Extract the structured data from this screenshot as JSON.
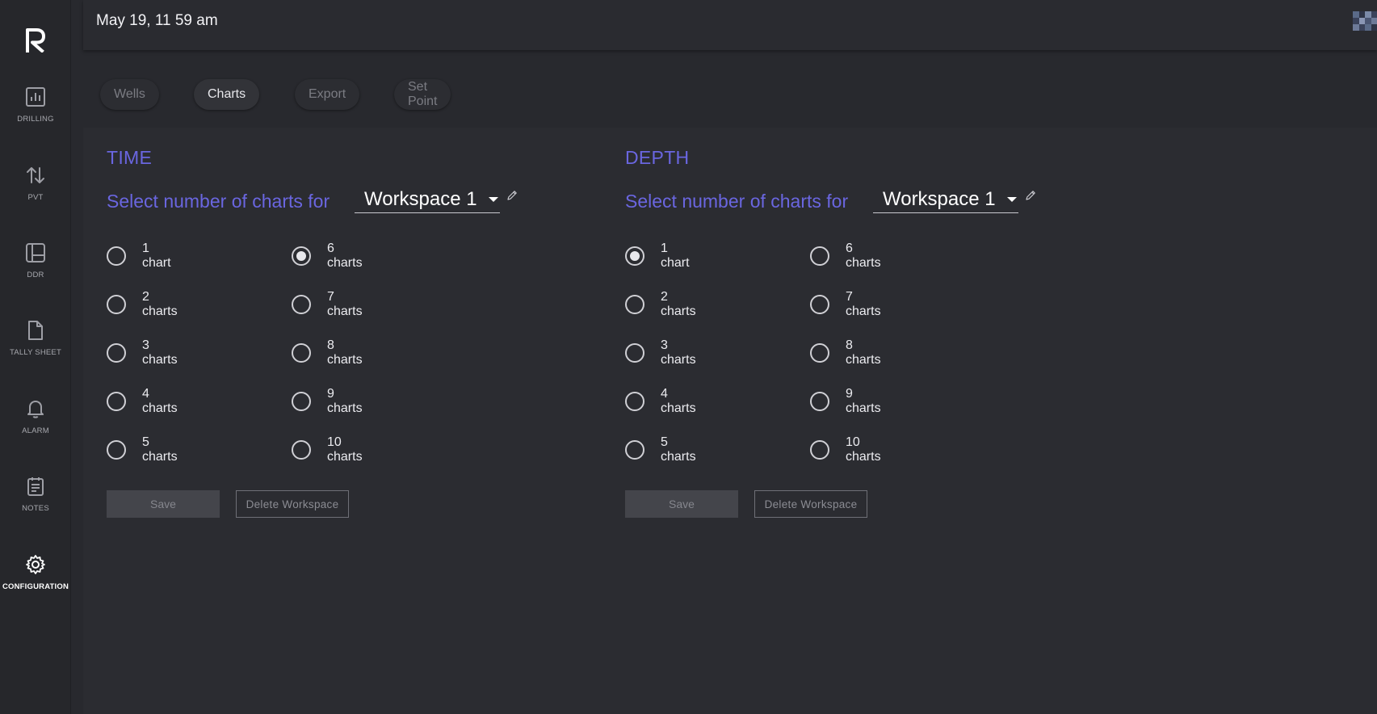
{
  "header": {
    "datetime": "May 19, 11 59 am"
  },
  "sidebar": {
    "items": [
      {
        "label": "DRILLING",
        "icon": "bar-chart-icon"
      },
      {
        "label": "PVT",
        "icon": "sort-arrows-icon"
      },
      {
        "label": "DDR",
        "icon": "layout-icon"
      },
      {
        "label": "TALLY SHEET",
        "icon": "document-icon"
      },
      {
        "label": "ALARM",
        "icon": "bell-icon"
      },
      {
        "label": "NOTES",
        "icon": "notes-icon"
      },
      {
        "label": "CONFIGURATION",
        "icon": "gear-icon",
        "active": true
      }
    ]
  },
  "tabs": [
    {
      "label": "Wells",
      "active": false
    },
    {
      "label": "Charts",
      "active": true
    },
    {
      "label": "Export",
      "active": false
    },
    {
      "label": "Set Point",
      "active": false
    }
  ],
  "time": {
    "title": "TIME",
    "select_label": "Select number of charts for",
    "workspace": "Workspace 1",
    "selected": "6 charts",
    "options": [
      "1 chart",
      "2 charts",
      "3 charts",
      "4 charts",
      "5 charts",
      "6 charts",
      "7 charts",
      "8 charts",
      "9 charts",
      "10 charts"
    ],
    "save_label": "Save",
    "delete_label": "Delete Workspace"
  },
  "depth": {
    "title": "DEPTH",
    "select_label": "Select number of charts for",
    "workspace": "Workspace 1",
    "selected": "1 chart",
    "options": [
      "1 chart",
      "2 charts",
      "3 charts",
      "4 charts",
      "5 charts",
      "6 charts",
      "7 charts",
      "8 charts",
      "9 charts",
      "10 charts"
    ],
    "save_label": "Save",
    "delete_label": "Delete Workspace"
  },
  "colors": {
    "accent": "#6a66e0",
    "background": "#28292e",
    "panel": "#2b2c31"
  }
}
